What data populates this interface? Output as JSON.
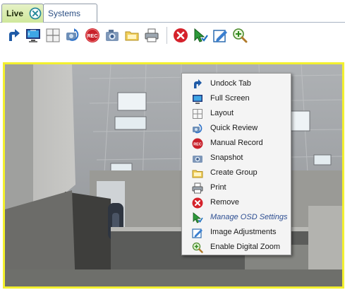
{
  "tabs": [
    {
      "label": "Live",
      "active": true
    },
    {
      "label": "Systems",
      "active": false
    }
  ],
  "toolbar": {
    "icons": [
      "undock-icon",
      "full-screen-icon",
      "layout-icon",
      "quick-review-icon",
      "manual-record-icon",
      "snapshot-icon",
      "create-group-icon",
      "print-icon",
      "remove-icon",
      "manage-osd-icon",
      "image-adjustments-icon",
      "digital-zoom-icon"
    ]
  },
  "context_menu": {
    "items": [
      {
        "label": "Undock Tab",
        "icon": "undock-icon"
      },
      {
        "label": "Full Screen",
        "icon": "full-screen-icon"
      },
      {
        "label": "Layout",
        "icon": "layout-icon"
      },
      {
        "label": "Quick Review",
        "icon": "quick-review-icon"
      },
      {
        "label": "Manual Record",
        "icon": "manual-record-icon"
      },
      {
        "label": "Snapshot",
        "icon": "snapshot-icon"
      },
      {
        "label": "Create Group",
        "icon": "create-group-icon"
      },
      {
        "label": "Print",
        "icon": "print-icon"
      },
      {
        "label": "Remove",
        "icon": "remove-icon"
      },
      {
        "label": "Manage OSD Settings",
        "icon": "manage-osd-icon",
        "highlighted": true
      },
      {
        "label": "Image Adjustments",
        "icon": "image-adjustments-icon"
      },
      {
        "label": "Enable Digital Zoom",
        "icon": "digital-zoom-icon"
      }
    ]
  },
  "colors": {
    "video_border": "#f3f02e",
    "live_tab": "#cfe79b",
    "highlight_text": "#2c4d91"
  }
}
